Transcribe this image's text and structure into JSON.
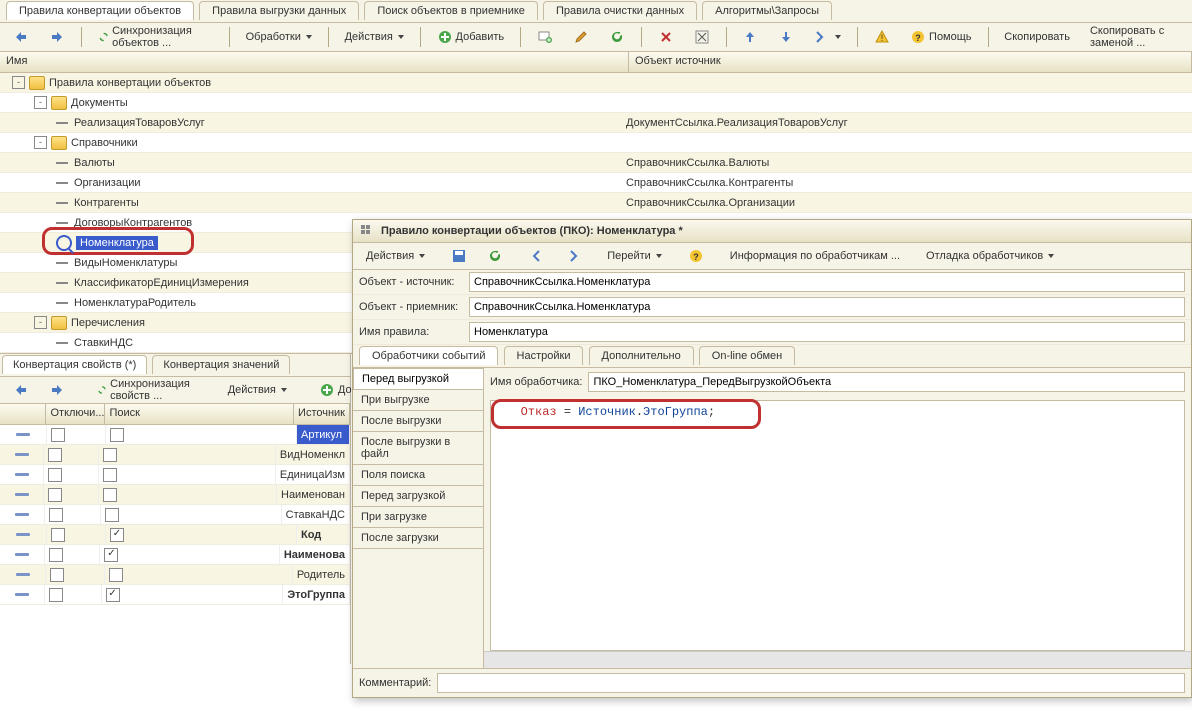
{
  "tabs": [
    "Правила конвертации объектов",
    "Правила выгрузки данных",
    "Поиск объектов в приемнике",
    "Правила очистки данных",
    "Алгоритмы\\Запросы"
  ],
  "active_tab": 0,
  "toolbar": {
    "sync": "Синхронизация объектов ...",
    "handlers": "Обработки",
    "actions": "Действия",
    "add": "Добавить",
    "help": "Помощь",
    "copy": "Скопировать",
    "copy_replace": "Скопировать с заменой ..."
  },
  "columns": {
    "name": "Имя",
    "source": "Объект источник"
  },
  "tree": [
    {
      "lvl": 0,
      "exp": "-",
      "type": "folder",
      "label": "Правила конвертации объектов",
      "src": ""
    },
    {
      "lvl": 1,
      "exp": "-",
      "type": "folder",
      "label": "Документы",
      "src": ""
    },
    {
      "lvl": 2,
      "exp": "",
      "type": "item",
      "label": "РеализацияТоваровУслуг",
      "src": "ДокументСсылка.РеализацияТоваровУслуг"
    },
    {
      "lvl": 1,
      "exp": "-",
      "type": "folder",
      "label": "Справочники",
      "src": ""
    },
    {
      "lvl": 2,
      "exp": "",
      "type": "item",
      "label": "Валюты",
      "src": "СправочникСсылка.Валюты"
    },
    {
      "lvl": 2,
      "exp": "",
      "type": "item",
      "label": "Организации",
      "src": "СправочникСсылка.Контрагенты"
    },
    {
      "lvl": 2,
      "exp": "",
      "type": "item",
      "label": "Контрагенты",
      "src": "СправочникСсылка.Организации"
    },
    {
      "lvl": 2,
      "exp": "",
      "type": "item",
      "label": "ДоговорыКонтрагентов",
      "src": ""
    },
    {
      "lvl": 2,
      "exp": "",
      "type": "search",
      "label": "Номенклатура",
      "src": "",
      "sel": true
    },
    {
      "lvl": 2,
      "exp": "",
      "type": "item",
      "label": "ВидыНоменклатуры",
      "src": ""
    },
    {
      "lvl": 2,
      "exp": "",
      "type": "item",
      "label": "КлассификаторЕдиницИзмерения",
      "src": ""
    },
    {
      "lvl": 2,
      "exp": "",
      "type": "item",
      "label": "НоменклатураРодитель",
      "src": ""
    },
    {
      "lvl": 1,
      "exp": "-",
      "type": "folder",
      "label": "Перечисления",
      "src": ""
    },
    {
      "lvl": 2,
      "exp": "",
      "type": "item",
      "label": "СтавкиНДС",
      "src": ""
    }
  ],
  "prop_tabs": [
    "Конвертация свойств (*)",
    "Конвертация значений"
  ],
  "prop_toolbar": {
    "sync": "Синхронизация свойств ...",
    "actions": "Действия",
    "add": "Добавить"
  },
  "prop_cols": {
    "mark": "",
    "off": "Отключи...",
    "find": "Поиск",
    "src": "Источник"
  },
  "prop_rows": [
    {
      "off": false,
      "find": false,
      "src": "Артикул",
      "sel": true,
      "bold": false
    },
    {
      "off": false,
      "find": false,
      "src": "ВидНоменкл",
      "bold": false
    },
    {
      "off": false,
      "find": false,
      "src": "ЕдиницаИзм",
      "bold": false
    },
    {
      "off": false,
      "find": false,
      "src": "Наименован",
      "bold": false
    },
    {
      "off": false,
      "find": false,
      "src": "СтавкаНДС",
      "bold": false
    },
    {
      "off": false,
      "find": true,
      "src": "Код",
      "bold": true
    },
    {
      "off": false,
      "find": true,
      "src": "Наименова",
      "bold": true
    },
    {
      "off": false,
      "find": false,
      "src": "Родитель",
      "bold": false
    },
    {
      "off": false,
      "find": true,
      "src": "ЭтоГруппа",
      "bold": true
    }
  ],
  "popup": {
    "title": "Правило конвертации объектов (ПКО): Номенклатура *",
    "toolbar": {
      "actions": "Действия",
      "goto": "Перейти",
      "info": "Информация по обработчикам ...",
      "debug": "Отладка обработчиков"
    },
    "form": {
      "src_label": "Объект - источник:",
      "src_val": "СправочникСсылка.Номенклатура",
      "dst_label": "Объект - приемник:",
      "dst_val": "СправочникСсылка.Номенклатура",
      "rule_label": "Имя правила:",
      "rule_val": "Номенклатура"
    },
    "inner_tabs": [
      "Обработчики событий",
      "Настройки",
      "Дополнительно",
      "On-line обмен"
    ],
    "handlers": [
      "Перед выгрузкой",
      "При выгрузке",
      "После выгрузки",
      "После выгрузки в файл",
      "Поля поиска",
      "Перед загрузкой",
      "При загрузке",
      "После загрузки"
    ],
    "handler_sel": 0,
    "handler_name_label": "Имя обработчика:",
    "handler_name_val": "ПКО_Номенклатура_ПередВыгрузкойОбъекта",
    "code": {
      "k1": "Отказ",
      "eq": " = ",
      "k2": "Источник",
      "dot": ".",
      "k3": "ЭтоГруппа",
      "semi": ";"
    },
    "comment_label": "Комментарий:",
    "comment_val": ""
  }
}
